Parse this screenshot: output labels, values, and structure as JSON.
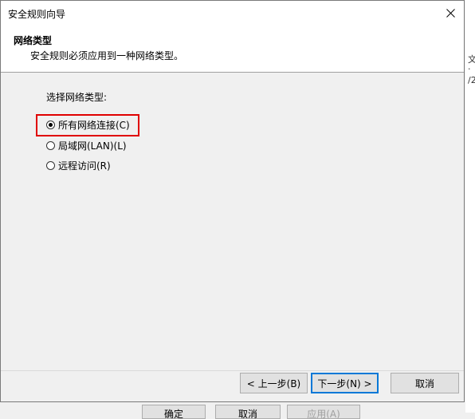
{
  "background": {
    "right_texts": [
      "文",
      "·",
      "/2"
    ],
    "bottom_buttons": [
      "确定",
      "取消",
      "应用(A)"
    ]
  },
  "dialog": {
    "title": "安全规则向导",
    "header": {
      "title": "网络类型",
      "subtitle": "安全规则必须应用到一种网络类型。"
    },
    "prompt": "选择网络类型:",
    "options": [
      {
        "label": "所有网络连接(C)",
        "checked": true
      },
      {
        "label": "局域网(LAN)(L)",
        "checked": false
      },
      {
        "label": "远程访问(R)",
        "checked": false
      }
    ],
    "buttons": {
      "back": "< 上一步(B)",
      "next": "下一步(N) >",
      "cancel": "取消"
    }
  },
  "colors": {
    "highlight": "#e00000",
    "default_button_border": "#0078d7"
  }
}
